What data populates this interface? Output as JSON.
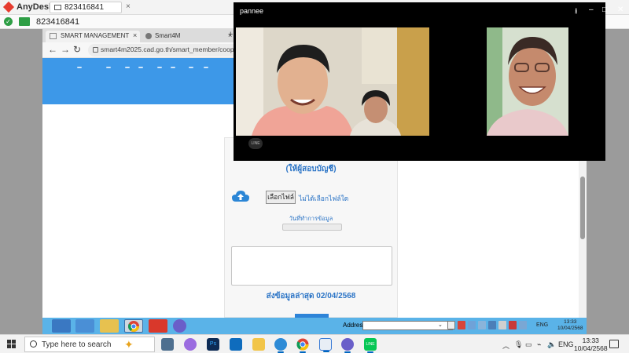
{
  "anydesk": {
    "app_name": "AnyDesk",
    "tab_label": "823416841",
    "tab_close": "×",
    "address_value": "823416841"
  },
  "browser": {
    "tabs": [
      {
        "label": "SMART MANAGEMENT",
        "close": "×"
      },
      {
        "label": "Smart4M",
        "close": "×"
      }
    ],
    "new_tab": "+",
    "url": "smart4m2025.cad.go.th/smart_member/coop_admin/u"
  },
  "form": {
    "heading": "(ให้ผู้สอบบัญชี)",
    "choose_file_label": "เลือกไฟล์",
    "no_file_text": "ไม่ได้เลือกไฟล์ใด",
    "date_label": "วันที่ทำการข้อมูล",
    "last_sent": "ส่งข้อมูลล่าสุด 02/04/2568"
  },
  "video_call": {
    "caller_name": "pannee",
    "logo_text": "LINE"
  },
  "remote_taskbar": {
    "address_label": "Address",
    "lang": "ENG",
    "time": "13:33",
    "date": "10/04/2568"
  },
  "windows_taskbar": {
    "search_placeholder": "Type here to search",
    "lang": "ENG",
    "time": "13:33",
    "date": "10/04/2568"
  },
  "colors": {
    "banner_blue": "#3d98e8",
    "link_blue": "#2b74c6",
    "anydesk_red": "#e63b2e",
    "status_green": "#2e9e45"
  }
}
